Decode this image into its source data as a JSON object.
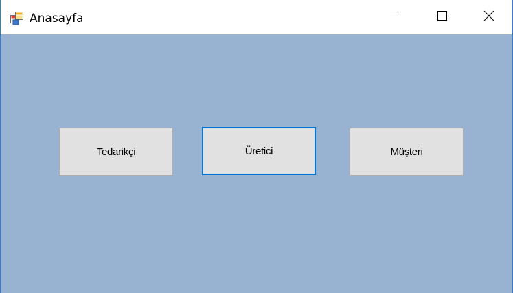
{
  "window": {
    "title": "Anasayfa",
    "icon": "app-window-icon",
    "controls": {
      "minimize_icon": "minimize-icon",
      "maximize_icon": "maximize-icon",
      "close_icon": "close-icon"
    },
    "client_background": "#98b2d1"
  },
  "buttons": [
    {
      "label": "Tedarikçi",
      "focused": false
    },
    {
      "label": "Üretici",
      "focused": true
    },
    {
      "label": "Müşteri",
      "focused": false
    }
  ],
  "colors": {
    "focus_accent": "#0078d7",
    "button_face": "#e1e1e1"
  }
}
